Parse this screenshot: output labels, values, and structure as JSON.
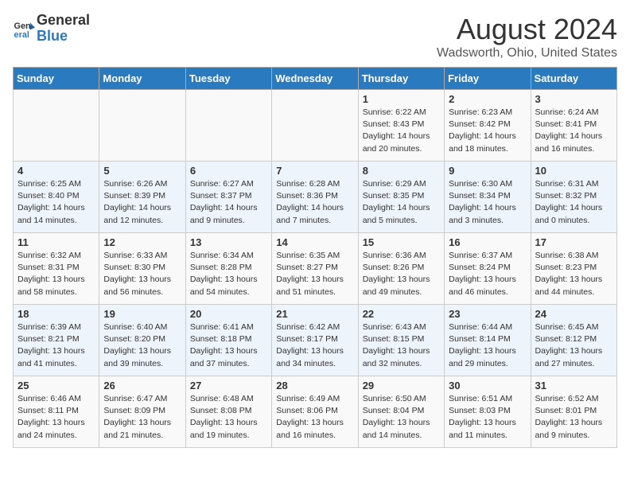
{
  "header": {
    "logo_general": "General",
    "logo_blue": "Blue",
    "month": "August 2024",
    "location": "Wadsworth, Ohio, United States"
  },
  "days_of_week": [
    "Sunday",
    "Monday",
    "Tuesday",
    "Wednesday",
    "Thursday",
    "Friday",
    "Saturday"
  ],
  "weeks": [
    [
      {
        "day": "",
        "info": ""
      },
      {
        "day": "",
        "info": ""
      },
      {
        "day": "",
        "info": ""
      },
      {
        "day": "",
        "info": ""
      },
      {
        "day": "1",
        "info": "Sunrise: 6:22 AM\nSunset: 8:43 PM\nDaylight: 14 hours and 20 minutes."
      },
      {
        "day": "2",
        "info": "Sunrise: 6:23 AM\nSunset: 8:42 PM\nDaylight: 14 hours and 18 minutes."
      },
      {
        "day": "3",
        "info": "Sunrise: 6:24 AM\nSunset: 8:41 PM\nDaylight: 14 hours and 16 minutes."
      }
    ],
    [
      {
        "day": "4",
        "info": "Sunrise: 6:25 AM\nSunset: 8:40 PM\nDaylight: 14 hours and 14 minutes."
      },
      {
        "day": "5",
        "info": "Sunrise: 6:26 AM\nSunset: 8:39 PM\nDaylight: 14 hours and 12 minutes."
      },
      {
        "day": "6",
        "info": "Sunrise: 6:27 AM\nSunset: 8:37 PM\nDaylight: 14 hours and 9 minutes."
      },
      {
        "day": "7",
        "info": "Sunrise: 6:28 AM\nSunset: 8:36 PM\nDaylight: 14 hours and 7 minutes."
      },
      {
        "day": "8",
        "info": "Sunrise: 6:29 AM\nSunset: 8:35 PM\nDaylight: 14 hours and 5 minutes."
      },
      {
        "day": "9",
        "info": "Sunrise: 6:30 AM\nSunset: 8:34 PM\nDaylight: 14 hours and 3 minutes."
      },
      {
        "day": "10",
        "info": "Sunrise: 6:31 AM\nSunset: 8:32 PM\nDaylight: 14 hours and 0 minutes."
      }
    ],
    [
      {
        "day": "11",
        "info": "Sunrise: 6:32 AM\nSunset: 8:31 PM\nDaylight: 13 hours and 58 minutes."
      },
      {
        "day": "12",
        "info": "Sunrise: 6:33 AM\nSunset: 8:30 PM\nDaylight: 13 hours and 56 minutes."
      },
      {
        "day": "13",
        "info": "Sunrise: 6:34 AM\nSunset: 8:28 PM\nDaylight: 13 hours and 54 minutes."
      },
      {
        "day": "14",
        "info": "Sunrise: 6:35 AM\nSunset: 8:27 PM\nDaylight: 13 hours and 51 minutes."
      },
      {
        "day": "15",
        "info": "Sunrise: 6:36 AM\nSunset: 8:26 PM\nDaylight: 13 hours and 49 minutes."
      },
      {
        "day": "16",
        "info": "Sunrise: 6:37 AM\nSunset: 8:24 PM\nDaylight: 13 hours and 46 minutes."
      },
      {
        "day": "17",
        "info": "Sunrise: 6:38 AM\nSunset: 8:23 PM\nDaylight: 13 hours and 44 minutes."
      }
    ],
    [
      {
        "day": "18",
        "info": "Sunrise: 6:39 AM\nSunset: 8:21 PM\nDaylight: 13 hours and 41 minutes."
      },
      {
        "day": "19",
        "info": "Sunrise: 6:40 AM\nSunset: 8:20 PM\nDaylight: 13 hours and 39 minutes."
      },
      {
        "day": "20",
        "info": "Sunrise: 6:41 AM\nSunset: 8:18 PM\nDaylight: 13 hours and 37 minutes."
      },
      {
        "day": "21",
        "info": "Sunrise: 6:42 AM\nSunset: 8:17 PM\nDaylight: 13 hours and 34 minutes."
      },
      {
        "day": "22",
        "info": "Sunrise: 6:43 AM\nSunset: 8:15 PM\nDaylight: 13 hours and 32 minutes."
      },
      {
        "day": "23",
        "info": "Sunrise: 6:44 AM\nSunset: 8:14 PM\nDaylight: 13 hours and 29 minutes."
      },
      {
        "day": "24",
        "info": "Sunrise: 6:45 AM\nSunset: 8:12 PM\nDaylight: 13 hours and 27 minutes."
      }
    ],
    [
      {
        "day": "25",
        "info": "Sunrise: 6:46 AM\nSunset: 8:11 PM\nDaylight: 13 hours and 24 minutes."
      },
      {
        "day": "26",
        "info": "Sunrise: 6:47 AM\nSunset: 8:09 PM\nDaylight: 13 hours and 21 minutes."
      },
      {
        "day": "27",
        "info": "Sunrise: 6:48 AM\nSunset: 8:08 PM\nDaylight: 13 hours and 19 minutes."
      },
      {
        "day": "28",
        "info": "Sunrise: 6:49 AM\nSunset: 8:06 PM\nDaylight: 13 hours and 16 minutes."
      },
      {
        "day": "29",
        "info": "Sunrise: 6:50 AM\nSunset: 8:04 PM\nDaylight: 13 hours and 14 minutes."
      },
      {
        "day": "30",
        "info": "Sunrise: 6:51 AM\nSunset: 8:03 PM\nDaylight: 13 hours and 11 minutes."
      },
      {
        "day": "31",
        "info": "Sunrise: 6:52 AM\nSunset: 8:01 PM\nDaylight: 13 hours and 9 minutes."
      }
    ]
  ]
}
